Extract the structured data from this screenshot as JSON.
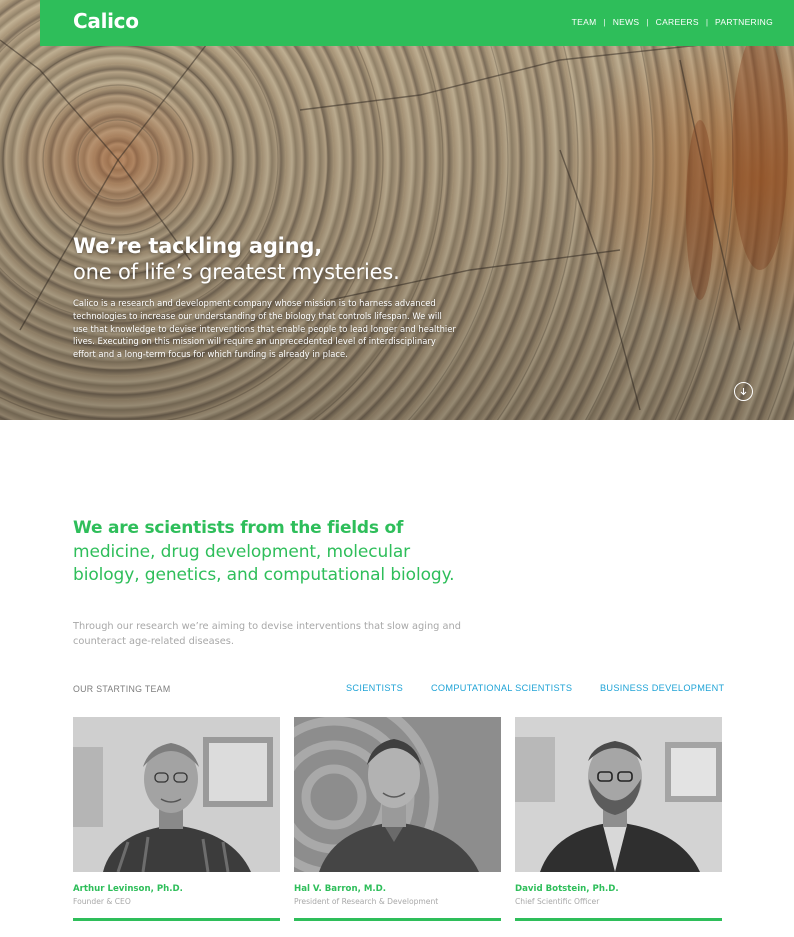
{
  "header": {
    "logo": "Calico",
    "nav": [
      {
        "label": "TEAM"
      },
      {
        "label": "NEWS"
      },
      {
        "label": "CAREERS"
      },
      {
        "label": "PARTNERING"
      }
    ],
    "separator": "|"
  },
  "hero": {
    "title": "We’re tackling aging,",
    "subtitle": "one of life’s greatest mysteries.",
    "body": "Calico is a research and development company whose mission is to harness advanced technologies to increase our understanding of the biology that controls lifespan. We will use that knowledge to devise interventions that enable people to lead longer and healthier lives. Executing on this mission will require an unprecedented level of interdisciplinary effort and a long-term focus for which funding is already in place.",
    "scroll_icon": "arrow-down-circle-icon"
  },
  "intro": {
    "headline_strong": "We are scientists from the fields of",
    "headline_light": "medicine, drug development, molecular biology, genetics, and computational biology.",
    "description": "Through our research we’re aiming to devise interventions that slow aging and counteract age-related diseases."
  },
  "team": {
    "label": "OUR STARTING TEAM",
    "filters": [
      {
        "label": "SCIENTISTS"
      },
      {
        "label": "COMPUTATIONAL SCIENTISTS"
      },
      {
        "label": "BUSINESS DEVELOPMENT"
      }
    ],
    "members": [
      {
        "name": "Arthur Levinson, Ph.D.",
        "role": "Founder & CEO"
      },
      {
        "name": "Hal V. Barron, M.D.",
        "role": "President of Research & Development"
      },
      {
        "name": "David Botstein, Ph.D.",
        "role": "Chief Scientific Officer"
      }
    ]
  },
  "colors": {
    "brand_green": "#2ebe5a",
    "link_blue": "#1fa3d6",
    "muted_gray": "#a8a8a8"
  }
}
